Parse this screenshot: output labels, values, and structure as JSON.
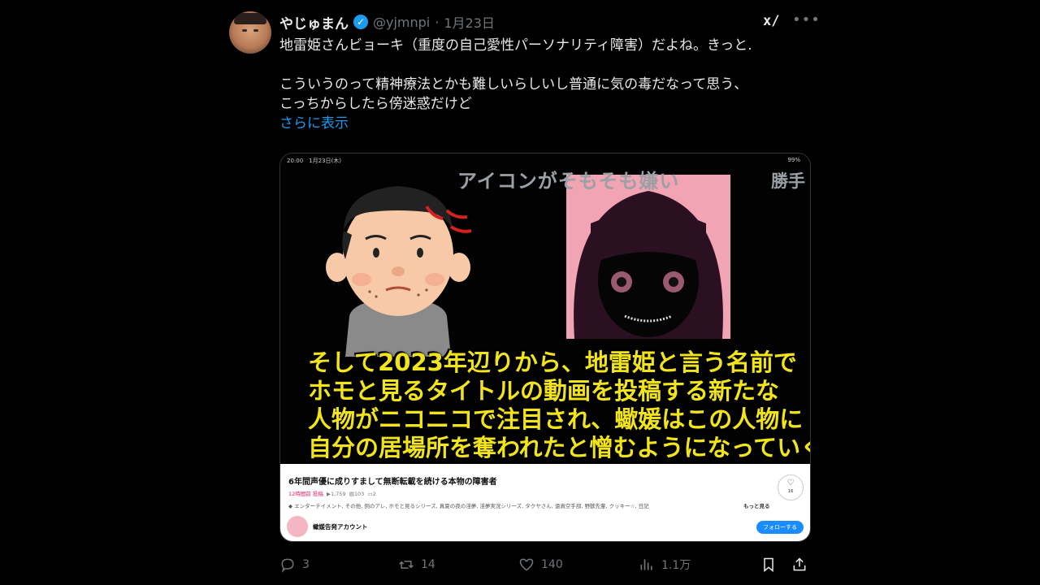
{
  "tweet": {
    "display_name": "やじゅまん",
    "handle": "@yjmnpi",
    "separator": "·",
    "date": "1月23日",
    "text_line1": "地雷姫さんビョーキ（重度の自己愛性パーソナリティ障害）だよね。きっと.",
    "text_line2": "こういうのって精神療法とかも難しいらしいし普通に気の毒だなって思う、",
    "text_line3": "こっちからしたら傍迷惑だけど",
    "show_more": "さらに表示"
  },
  "media": {
    "status_time": "20:00　1月23日(木)",
    "status_battery": "99%",
    "overlay_top": "アイコンがそもそも嫌い",
    "overlay_right": "勝手",
    "subtitle_1": "そして2023年辺りから、地雷姫と言う名前で",
    "subtitle_2": "ホモと見るタイトルの動画を投稿する新たな",
    "subtitle_3": "人物がニコニコで注目され、蠍媛はこの人物に",
    "subtitle_4": "自分の居場所を奪われたと憎むようになっていく",
    "video_title": "6年間声優に成りすまして無断転載を続ける本物の障害者",
    "posted": "12時間前 投稿",
    "views": "▶1,759",
    "comments": "103",
    "mylist": "2",
    "tags": "エンターテイメント, その他, 例のアレ, ホモと見るシリーズ, 真夏の夜の淫夢, 淫夢実況シリーズ, タクヤさん, 遠真空手部, 野獣先輩, クッキー☆, 日記",
    "see_more": "もっと見る",
    "like_count": "16",
    "channel_name": "蠍媛告発アカウント",
    "follow_label": "フォローする"
  },
  "actions": {
    "replies": "3",
    "retweets": "14",
    "likes": "140",
    "views": "1.1万"
  },
  "colors": {
    "accent": "#1d9bf0",
    "muted": "#71767b",
    "subtitle": "#f2e41b"
  }
}
